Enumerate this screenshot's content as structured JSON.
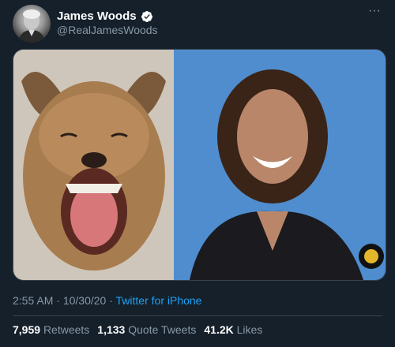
{
  "author": {
    "display_name": "James Woods",
    "handle": "@RealJamesWoods",
    "verified": true
  },
  "more_icon": "more-horizontal-icon",
  "meta": {
    "time": "2:55 AM",
    "separator1": " · ",
    "date": "10/30/20",
    "separator2": " · ",
    "source": "Twitter for iPhone"
  },
  "stats": {
    "retweets_count": "7,959",
    "retweets_label": "Retweets",
    "quote_count": "1,133",
    "quote_label": "Quote Tweets",
    "likes_count": "41.2K",
    "likes_label": "Likes"
  },
  "colors": {
    "background": "#15202b",
    "secondary_text": "#8899a6",
    "link": "#1da1f2",
    "verified": "#ffffff",
    "border": "#38444d"
  }
}
